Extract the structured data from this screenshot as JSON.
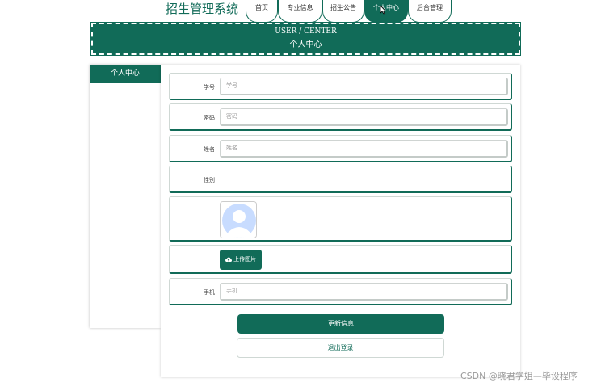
{
  "header": {
    "site_title": "招生管理系统",
    "tabs": [
      {
        "label": "首页",
        "active": false
      },
      {
        "label": "专业信息",
        "active": false
      },
      {
        "label": "招生公告",
        "active": false
      },
      {
        "label": "个人中心",
        "active": true
      },
      {
        "label": "后台管理",
        "active": false
      }
    ]
  },
  "banner": {
    "en": "USER / CENTER",
    "zh": "个人中心"
  },
  "sidebar": {
    "title": "个人中心"
  },
  "form": {
    "student_id": {
      "label": "学号",
      "placeholder": "学号"
    },
    "password": {
      "label": "密码",
      "placeholder": "密码"
    },
    "name": {
      "label": "姓名",
      "placeholder": "姓名"
    },
    "gender": {
      "label": "性别"
    },
    "upload_label": "上传图片",
    "phone": {
      "label": "手机",
      "placeholder": "手机"
    },
    "update_label": "更新信息",
    "logout_label": "退出登录"
  },
  "watermark": "CSDN @晓君学姐—毕设程序",
  "colors": {
    "primary": "#116b58",
    "avatar_bg": "#c8dcff"
  }
}
